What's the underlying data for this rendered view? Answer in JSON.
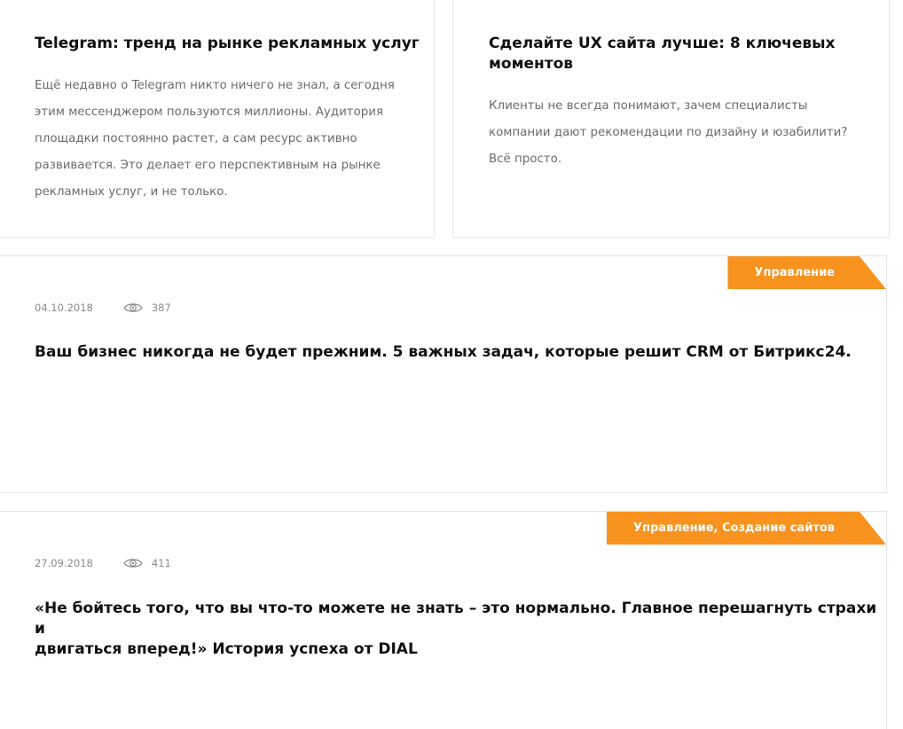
{
  "posts": [
    {
      "title": "Telegram: тренд на рынке рекламных услуг",
      "excerpt_lines": [
        "Ещё недавно о  Telegram никто ничего не знал, а сегодня",
        "этим мессенджером пользуются миллионы. Аудитория",
        "площадки постоянно растет, а сам ресурс активно",
        "развивается. Это делает его перспективным на рынке",
        "рекламных услуг, и не только."
      ]
    },
    {
      "title_lines": [
        "Сделайте UX сайта лучше: 8 ключевых",
        "моментов"
      ],
      "excerpt_lines": [
        "Клиенты не всегда понимают, зачем специалисты",
        "компании дают рекомендации по дизайну и юзабилити?",
        "Всё просто."
      ]
    },
    {
      "tag": "Управление",
      "date": "04.10.2018",
      "views": "387",
      "title": "Ваш бизнес никогда не будет прежним. 5 важных задач, которые решит CRM от Битрикс24."
    },
    {
      "tag": "Управление, Создание сайтов",
      "date": "27.09.2018",
      "views": "411",
      "title_lines": [
        "«Не бойтесь того, что вы что-то можете не знать – это нормально. Главное перешагнуть страхи и",
        "двигаться вперед!» История успеха от DIAL"
      ]
    }
  ],
  "colors": {
    "accent": "#f7931e",
    "title": "#111111",
    "text": "#6b6b6b",
    "meta": "#8a8a8a",
    "border": "#e6e6e6"
  },
  "icons": {
    "views": "eye-icon"
  }
}
